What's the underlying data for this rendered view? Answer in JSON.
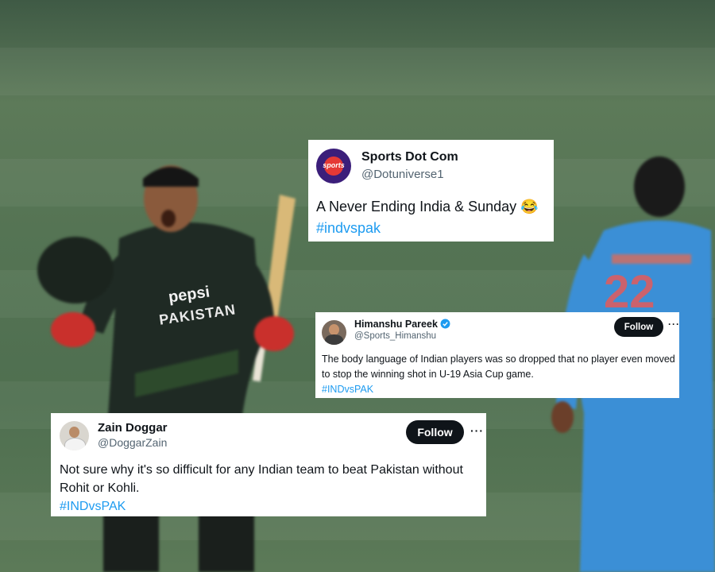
{
  "tweets": [
    {
      "name": "Sports Dot Com",
      "handle": "@Dotuniverse1",
      "avatar_text": "sports",
      "text": "A Never Ending India & Sunday 😂",
      "hashtag": "#indvspak"
    },
    {
      "name": "Himanshu Pareek",
      "handle": "@Sports_Himanshu",
      "verified": true,
      "follow_label": "Follow",
      "text": "The body language of Indian players was so dropped that no player even moved to stop the winning shot in U-19 Asia Cup game.",
      "hashtag": "#INDvsPAK"
    },
    {
      "name": "Zain Doggar",
      "handle": "@DoggarZain",
      "follow_label": "Follow",
      "text": "Not sure why it's so difficult for any Indian team to beat Pakistan without Rohit or Kohli.",
      "hashtag": "#INDvsPAK"
    }
  ],
  "photo": {
    "jersey_text": "PAKISTAN",
    "sponsor_text": "pepsi",
    "opponent_number": "22"
  },
  "colors": {
    "pakistan_jersey": "#1f2a24",
    "india_jersey": "#3b8fd6",
    "hashtag": "#1d9bf0",
    "verified": "#1d9bf0",
    "follow_button": "#0f1419"
  }
}
